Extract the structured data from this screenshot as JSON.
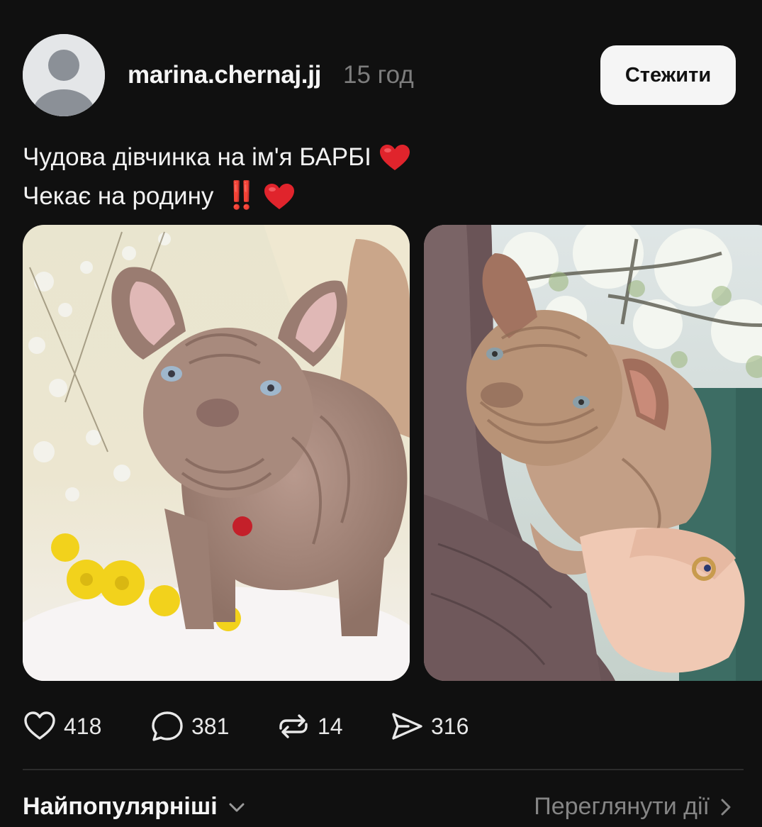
{
  "post": {
    "author": {
      "username": "marina.chernaj.jj",
      "time": "15 год"
    },
    "follow_label": "Стежити",
    "caption": {
      "line1": "Чудова дівчинка на ім'я БАРБІ",
      "line2": "Чекає на родину",
      "line2_emoji": "‼️"
    },
    "images": [
      {
        "icon": "puppy-photo-icon"
      },
      {
        "icon": "puppy-held-photo-icon"
      }
    ],
    "stats": {
      "likes": "418",
      "comments": "381",
      "reposts": "14",
      "shares": "316"
    }
  },
  "footer": {
    "sort_label": "Найпопулярніші",
    "activity_label": "Переглянути дії"
  },
  "colors": {
    "background": "#101010",
    "text": "#f3f3f3",
    "muted": "#7d7d7d",
    "heart": "#e0242c",
    "button_bg": "#f5f5f5"
  }
}
